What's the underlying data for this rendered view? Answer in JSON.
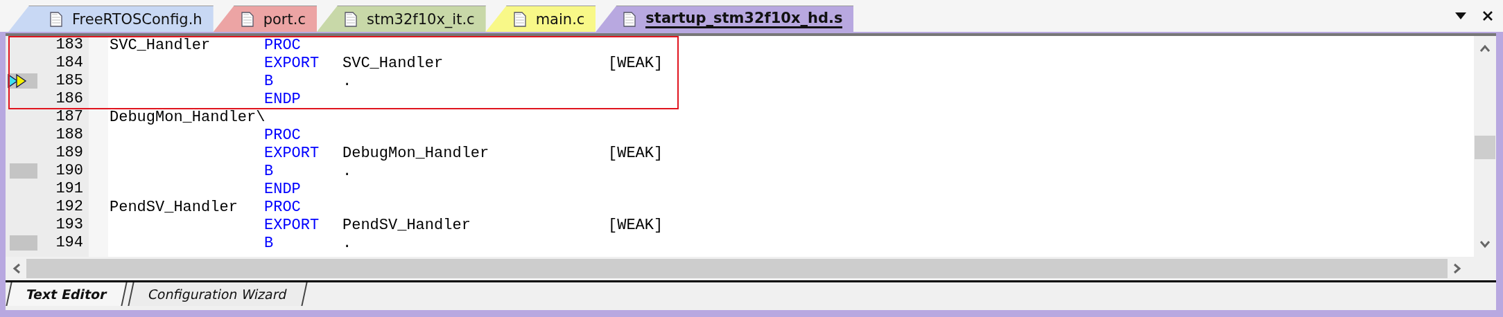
{
  "tabs": [
    {
      "label": "FreeRTOSConfig.h",
      "color": "#c8d8f4",
      "selected": false
    },
    {
      "label": "port.c",
      "color": "#eca4a4",
      "selected": false
    },
    {
      "label": "stm32f10x_it.c",
      "color": "#c8d8a8",
      "selected": false
    },
    {
      "label": "main.c",
      "color": "#f8f888",
      "selected": false
    },
    {
      "label": "startup_stm32f10x_hd.s",
      "color": "#b8a8e0",
      "selected": true
    }
  ],
  "editor": {
    "lines": [
      {
        "number": "183",
        "label": "SVC_Handler",
        "mnemonic": "PROC",
        "boxed": true
      },
      {
        "number": "184",
        "mnemonic": "EXPORT",
        "operand": "SVC_Handler",
        "attribute": "[WEAK]",
        "boxed": true
      },
      {
        "number": "185",
        "mnemonic": "B",
        "operand": ".",
        "code_line": true,
        "current": true,
        "boxed": true
      },
      {
        "number": "186",
        "mnemonic": "ENDP",
        "boxed": true
      },
      {
        "number": "187",
        "label": "DebugMon_Handler\\"
      },
      {
        "number": "188",
        "mnemonic": "PROC"
      },
      {
        "number": "189",
        "mnemonic": "EXPORT",
        "operand": "DebugMon_Handler",
        "attribute": "[WEAK]"
      },
      {
        "number": "190",
        "mnemonic": "B",
        "operand": ".",
        "code_line": true
      },
      {
        "number": "191",
        "mnemonic": "ENDP"
      },
      {
        "number": "192",
        "label": "PendSV_Handler",
        "mnemonic": "PROC"
      },
      {
        "number": "193",
        "mnemonic": "EXPORT",
        "operand": "PendSV_Handler",
        "attribute": "[WEAK]"
      },
      {
        "number": "194",
        "mnemonic": "B",
        "operand": ".",
        "code_line": true
      }
    ]
  },
  "bottom_tabs": [
    {
      "label": "Text Editor",
      "selected": true
    },
    {
      "label": "Configuration Wizard",
      "selected": false
    }
  ]
}
